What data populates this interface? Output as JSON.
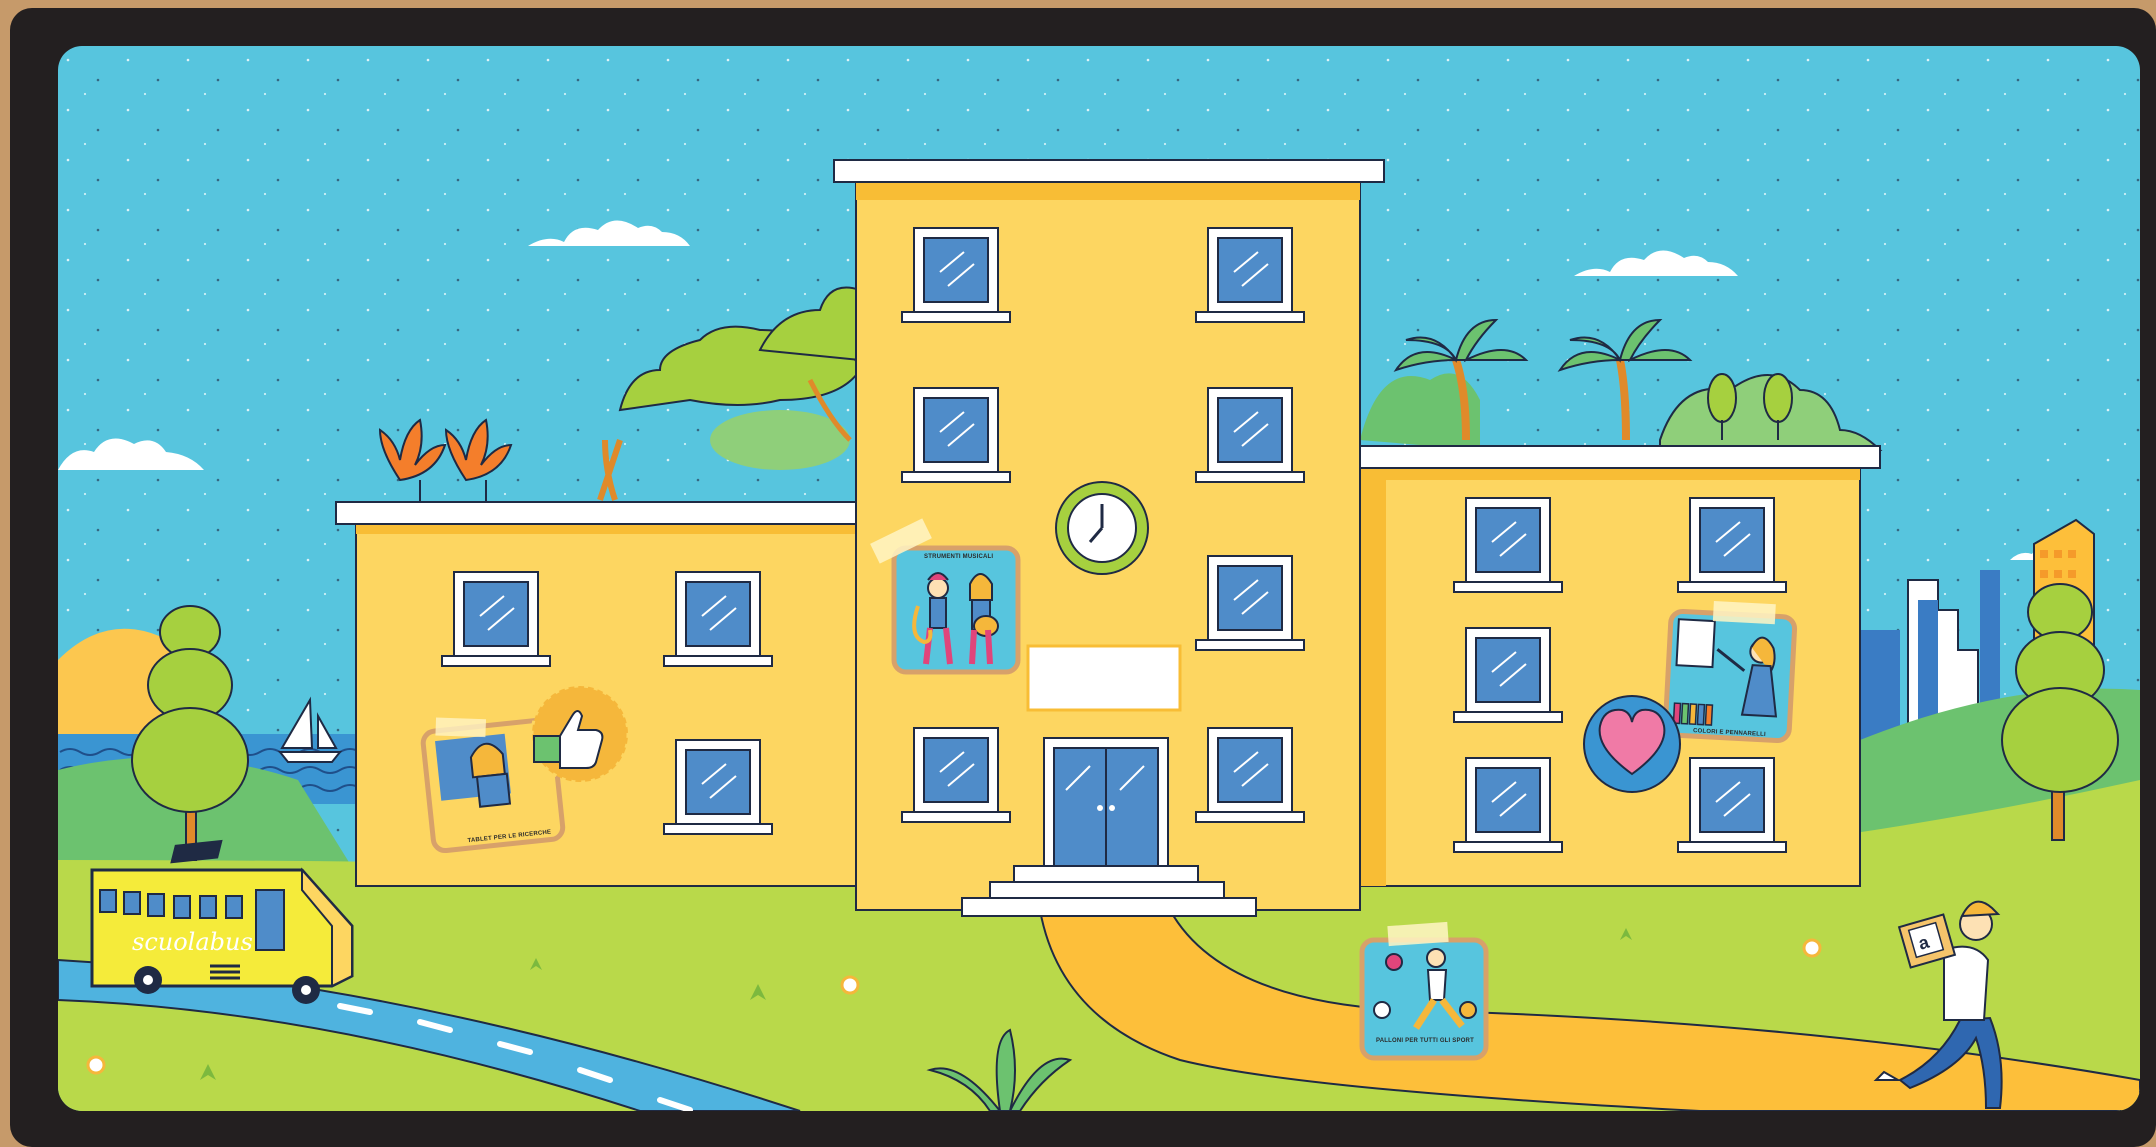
{
  "scene": {
    "stickers": [
      {
        "id": "tablet",
        "label": "TABLET PER LE RICERCHE"
      },
      {
        "id": "music",
        "label": "STRUMENTI MUSICALI"
      },
      {
        "id": "colors",
        "label": "COLORI E PENNARELLI"
      },
      {
        "id": "balls",
        "label": "PALLONI PER TUTTI GLI SPORT"
      }
    ],
    "badges": [
      {
        "id": "like",
        "icon": "thumbs-up-icon"
      },
      {
        "id": "love",
        "icon": "heart-icon"
      }
    ],
    "bus": {
      "label": "scuolabus"
    },
    "courier": {
      "package_label": "a"
    }
  },
  "colors": {
    "sky": "#57c5de",
    "building": "#fdd661",
    "building_shadow": "#f8bd35",
    "grass": "#b9d94a",
    "path": "#fdbf3a",
    "window": "#4f8cc9",
    "frame": "#231f20"
  }
}
